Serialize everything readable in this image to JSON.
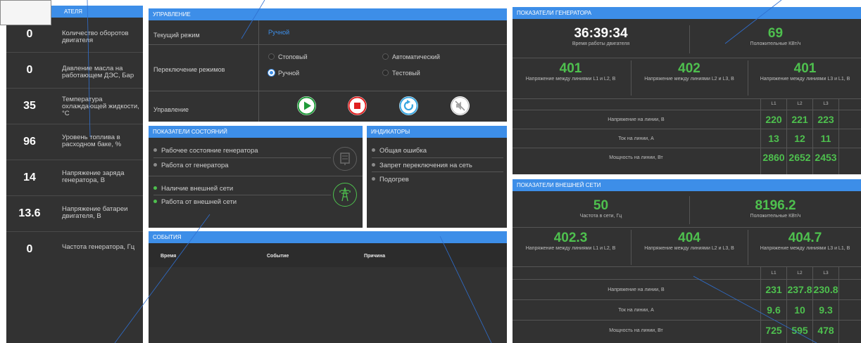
{
  "engine": {
    "header": "АТЕЛЯ",
    "rows": [
      {
        "value": "0",
        "label": "Количество оборотов двигателя"
      },
      {
        "value": "0",
        "label": "Давление масла на работающем ДЭС, Бар"
      },
      {
        "value": "35",
        "label": "Температура охлаждающей жидкости, °С"
      },
      {
        "value": "96",
        "label": "Уровень топлива в расходном баке, %"
      },
      {
        "value": "14",
        "label": "Напряжение заряда генератора, В"
      },
      {
        "value": "13.6",
        "label": "Напряжение батареи двигателя, В"
      },
      {
        "value": "0",
        "label": "Частота генератора, Гц"
      }
    ]
  },
  "control": {
    "header": "УПРАВЛЕНИЕ",
    "current_mode_label": "Текущий режим",
    "current_mode_value": "Ручной",
    "switch_label": "Переключение режимов",
    "modes": [
      "Стоповый",
      "Автоматический",
      "Ручной",
      "Тестовый"
    ],
    "selected_mode": "Ручной",
    "control_label": "Управление"
  },
  "states": {
    "header": "ПОКАЗАТЕЛИ СОСТОЯНИЙ",
    "items": [
      "Рабочее состояние генератора",
      "Работа от генератора",
      "Наличие внешней сети",
      "Работа от внешней сети"
    ]
  },
  "indicators": {
    "header": "ИНДИКАТОРЫ",
    "items": [
      "Общая ошибка",
      "Запрет переключения на сеть",
      "Подогрев"
    ]
  },
  "events": {
    "header": "СОБЫТИЯ",
    "columns": [
      "Время",
      "Событие",
      "Причина"
    ]
  },
  "generator": {
    "header": "ПОКАЗАТЕЛИ ГЕНЕРАТОРА",
    "runtime": "36:39:34",
    "runtime_label": "Время работы двигателя",
    "kwh": "69",
    "kwh_label": "Положительные КВт/ч",
    "line_voltages": [
      {
        "value": "401",
        "label": "Напряжение между линиями L1 и L2, В"
      },
      {
        "value": "402",
        "label": "Напряжение между линиями L2 и L3, В"
      },
      {
        "value": "401",
        "label": "Напряжение между линиями L3 и L1, В"
      }
    ],
    "phases": [
      "L1",
      "L2",
      "L3"
    ],
    "table": [
      {
        "label": "Напряжение на линии, В",
        "values": [
          "220",
          "221",
          "223"
        ]
      },
      {
        "label": "Ток на линии, А",
        "values": [
          "13",
          "12",
          "11"
        ]
      },
      {
        "label": "Мощность на линии, Вт",
        "values": [
          "2860",
          "2652",
          "2453"
        ]
      }
    ]
  },
  "external": {
    "header": "ПОКАЗАТЕЛИ ВНЕШНЕЙ СЕТИ",
    "freq": "50",
    "freq_label": "Частота в сети, Гц",
    "kwh": "8196.2",
    "kwh_label": "Положительные КВт/ч",
    "line_voltages": [
      {
        "value": "402.3",
        "label": "Напряжение между линиями L1 и L2, В"
      },
      {
        "value": "404",
        "label": "Напряжение между линиями L2 и L3, В"
      },
      {
        "value": "404.7",
        "label": "Напряжение между линиями L3 и L1, В"
      }
    ],
    "phases": [
      "L1",
      "L2",
      "L3"
    ],
    "table": [
      {
        "label": "Напряжение на линии, В",
        "values": [
          "231",
          "237.8",
          "230.8"
        ]
      },
      {
        "label": "Ток на линии, А",
        "values": [
          "9.6",
          "10",
          "9.3"
        ]
      },
      {
        "label": "Мощность на линии, Вт",
        "values": [
          "725",
          "595",
          "478"
        ]
      }
    ]
  },
  "colors": {
    "accent": "#3d8ee8",
    "value_green": "#4ec04e",
    "panel": "#323232",
    "stop_red": "#e02020",
    "play_green": "#1f9a3a",
    "reset_blue": "#39a6e0"
  }
}
